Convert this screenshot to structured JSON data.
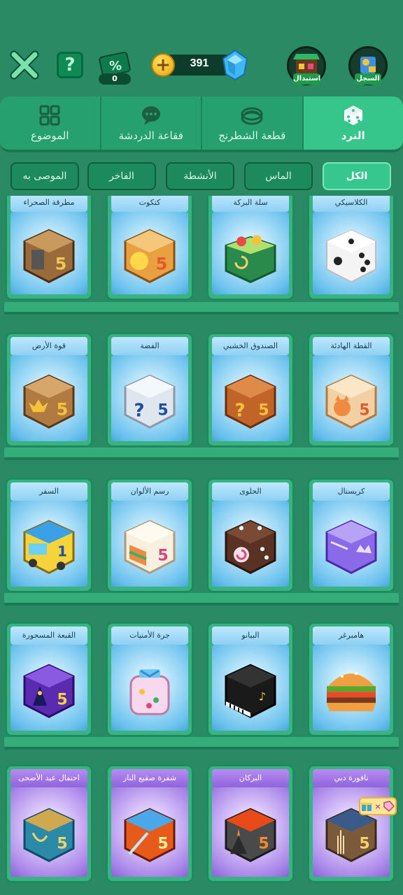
{
  "topbar": {
    "discount_count": "0",
    "coins": "391",
    "exchange_label": "استبدال",
    "history_label": "السجل"
  },
  "categories": [
    {
      "label": "الموضوع",
      "icon": "grid-icon"
    },
    {
      "label": "فقاعة الدردشة",
      "icon": "chat-bubble-icon"
    },
    {
      "label": "قطعة الشطرنج",
      "icon": "game-piece-icon"
    },
    {
      "label": "النرد",
      "icon": "dice-icon",
      "active": true
    }
  ],
  "filters": [
    {
      "label": "الموصى به"
    },
    {
      "label": "الفاخر"
    },
    {
      "label": "الأنشطة"
    },
    {
      "label": "الماس"
    },
    {
      "label": "الكل",
      "active": true
    }
  ],
  "rows": [
    [
      "مطرقة الصحراء",
      "كتكوت",
      "سلة البركة",
      "الكلاسيكي"
    ],
    [
      "قوة الأرض",
      "الفضة",
      "الصندوق الخشبي",
      "القطة الهادئة"
    ],
    [
      "السفر",
      "رسم الألوان",
      "الحلوى",
      "كريستال"
    ],
    [
      "القبعة المسحورة",
      "جرة الأمنيات",
      "البيانو",
      "هامبرغر"
    ],
    [
      "احتفال عيد الأضحى",
      "شفرة صقيع النار",
      "البركان",
      "نافورة دبي"
    ]
  ],
  "colors": {
    "background": "#2a8a63",
    "active_tab": "#36c58b",
    "card_blue": "#8fd0f3",
    "card_purple": "#9064dc"
  }
}
